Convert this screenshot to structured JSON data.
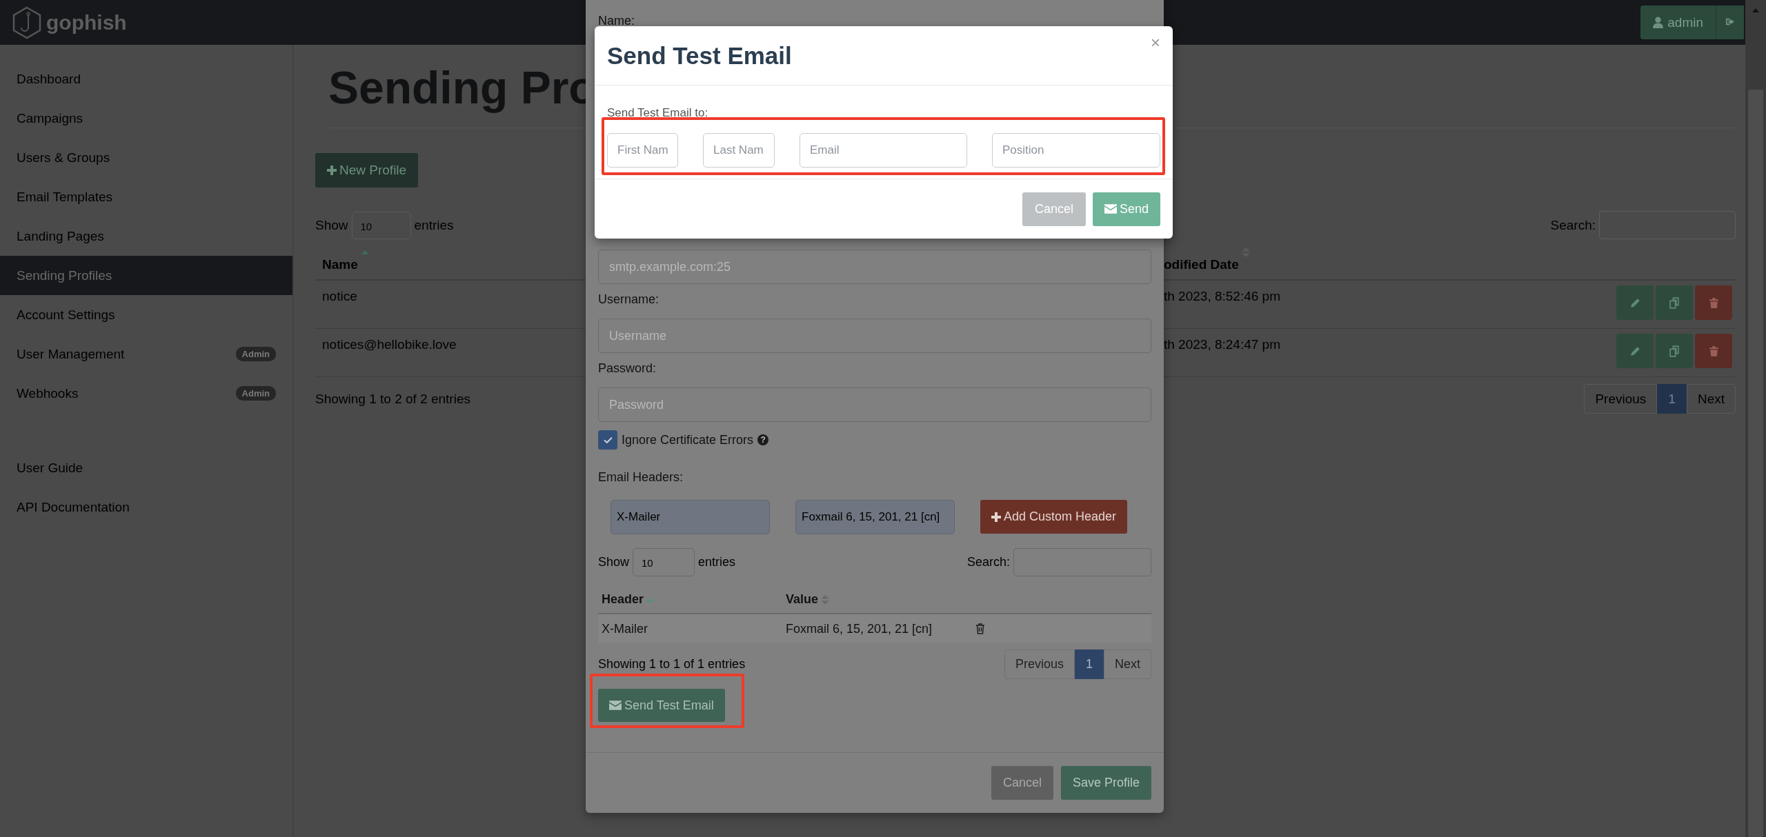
{
  "navbar": {
    "brand": "gophish",
    "user_button": "admin"
  },
  "sidebar": {
    "items": [
      {
        "label": "Dashboard",
        "selected": false
      },
      {
        "label": "Campaigns",
        "selected": false
      },
      {
        "label": "Users & Groups",
        "selected": false
      },
      {
        "label": "Email Templates",
        "selected": false
      },
      {
        "label": "Landing Pages",
        "selected": false
      },
      {
        "label": "Sending Profiles",
        "selected": true
      },
      {
        "label": "Account Settings",
        "selected": false
      },
      {
        "label": "User Management",
        "selected": false,
        "badge": "Admin"
      },
      {
        "label": "Webhooks",
        "selected": false,
        "badge": "Admin"
      }
    ],
    "links": [
      {
        "label": "User Guide"
      },
      {
        "label": "API Documentation"
      }
    ]
  },
  "page": {
    "title": "Sending Pro",
    "new_button": "New Profile",
    "show_label": "Show",
    "page_length": "10",
    "entries_label": "entries",
    "search_label": "Search:",
    "columns": [
      {
        "label": "Name",
        "sorted": true
      },
      {
        "label": "odified Date",
        "sorted": false
      }
    ],
    "rows": [
      {
        "name": "notice",
        "modified": "th 2023, 8:52:46 pm"
      },
      {
        "name": "notices@hellobike.love",
        "modified": "th 2023, 8:24:47 pm"
      }
    ],
    "info": "Showing 1 to 2 of 2 entries",
    "pagination": {
      "previous": "Previous",
      "pages": [
        {
          "label": "1",
          "selected": true
        }
      ],
      "next": "Next"
    }
  },
  "profile_modal": {
    "name_label": "Name:",
    "host_placeholder": "smtp.example.com:25",
    "username_label": "Username:",
    "username_placeholder": "Username",
    "password_label": "Password:",
    "password_placeholder": "Password",
    "ignore_cert": {
      "label": "Ignore Certificate Errors",
      "checked": true,
      "help": "?"
    },
    "headers_label": "Email Headers:",
    "header_key": "X-Mailer",
    "header_value": "Foxmail 6, 15, 201, 21 [cn]",
    "add_header_button": "Add Custom Header",
    "show_label": "Show",
    "page_length": "10",
    "entries_label": "entries",
    "search_label": "Search:",
    "columns": [
      {
        "label": "Header",
        "sorted": true
      },
      {
        "label": "Value",
        "sorted": false
      }
    ],
    "rows": [
      {
        "header": "X-Mailer",
        "value": "Foxmail 6, 15, 201, 21 [cn]"
      }
    ],
    "info": "Showing 1 to 1 of 1 entries",
    "pagination": {
      "previous": "Previous",
      "pages": [
        {
          "label": "1",
          "selected": true
        }
      ],
      "next": "Next"
    },
    "send_test_button": "Send Test Email",
    "cancel_button": "Cancel",
    "save_button": "Save Profile"
  },
  "test_modal": {
    "title": "Send Test Email",
    "close": "×",
    "label": "Send Test Email to:",
    "inputs": [
      {
        "placeholder": "First Nam"
      },
      {
        "placeholder": "Last Nam"
      },
      {
        "placeholder": "Email"
      },
      {
        "placeholder": "Position"
      }
    ],
    "cancel_button": "Cancel",
    "send_button": "Send"
  }
}
